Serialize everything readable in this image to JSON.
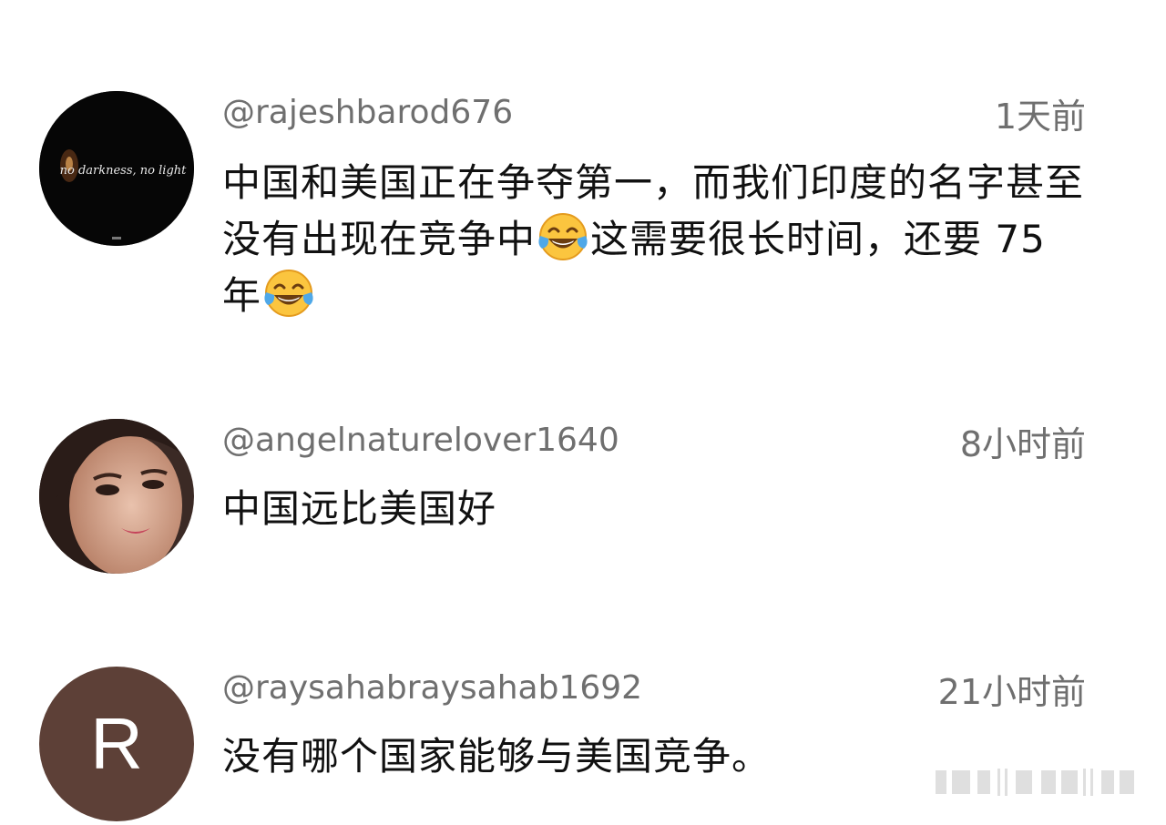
{
  "comments": [
    {
      "handle": "@rajeshbarod676",
      "time": "1天前",
      "avatar_text": "no darkness, no light",
      "text_parts": [
        "中国和美国正在争夺第一，而我们印度的名字甚至没有出现在竞争中",
        "这需要很长时间，还要 75 年"
      ],
      "emoji": "face-with-tears-of-joy-icon"
    },
    {
      "handle": "@angelnaturelover1640",
      "time": "8小时前",
      "text": "中国远比美国好"
    },
    {
      "handle": "@raysahabraysahab1692",
      "time": "21小时前",
      "avatar_letter": "R",
      "avatar_color": "#5d4037",
      "text": "没有哪个国家能够与美国竞争。"
    }
  ]
}
